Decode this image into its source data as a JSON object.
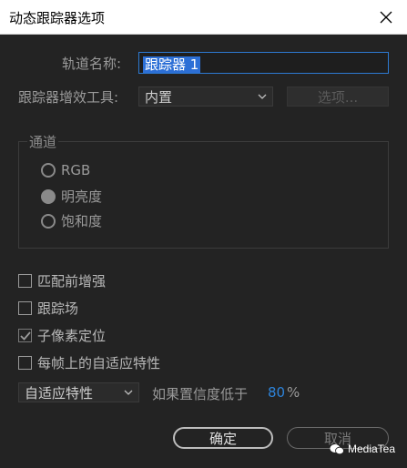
{
  "window": {
    "title": "动态跟踪器选项"
  },
  "form": {
    "track_name_label": "轨道名称:",
    "track_name_value": "跟踪器 1",
    "plugin_label": "跟踪器增效工具:",
    "plugin_value": "内置",
    "options_button": "选项..."
  },
  "channel": {
    "title": "通道",
    "options": [
      {
        "label": "RGB",
        "selected": false
      },
      {
        "label": "明亮度",
        "selected": true
      },
      {
        "label": "饱和度",
        "selected": false
      }
    ]
  },
  "checks": [
    {
      "label": "匹配前增强",
      "checked": false
    },
    {
      "label": "跟踪场",
      "checked": false
    },
    {
      "label": "子像素定位",
      "checked": true
    },
    {
      "label": "每帧上的自适应特性",
      "checked": false
    }
  ],
  "adaptive": {
    "select_value": "自适应特性",
    "condition_text": "如果置信度低于",
    "threshold": "80",
    "unit": "%"
  },
  "buttons": {
    "ok": "确定",
    "cancel": "取消"
  },
  "watermark": {
    "text": "MediaTea"
  }
}
